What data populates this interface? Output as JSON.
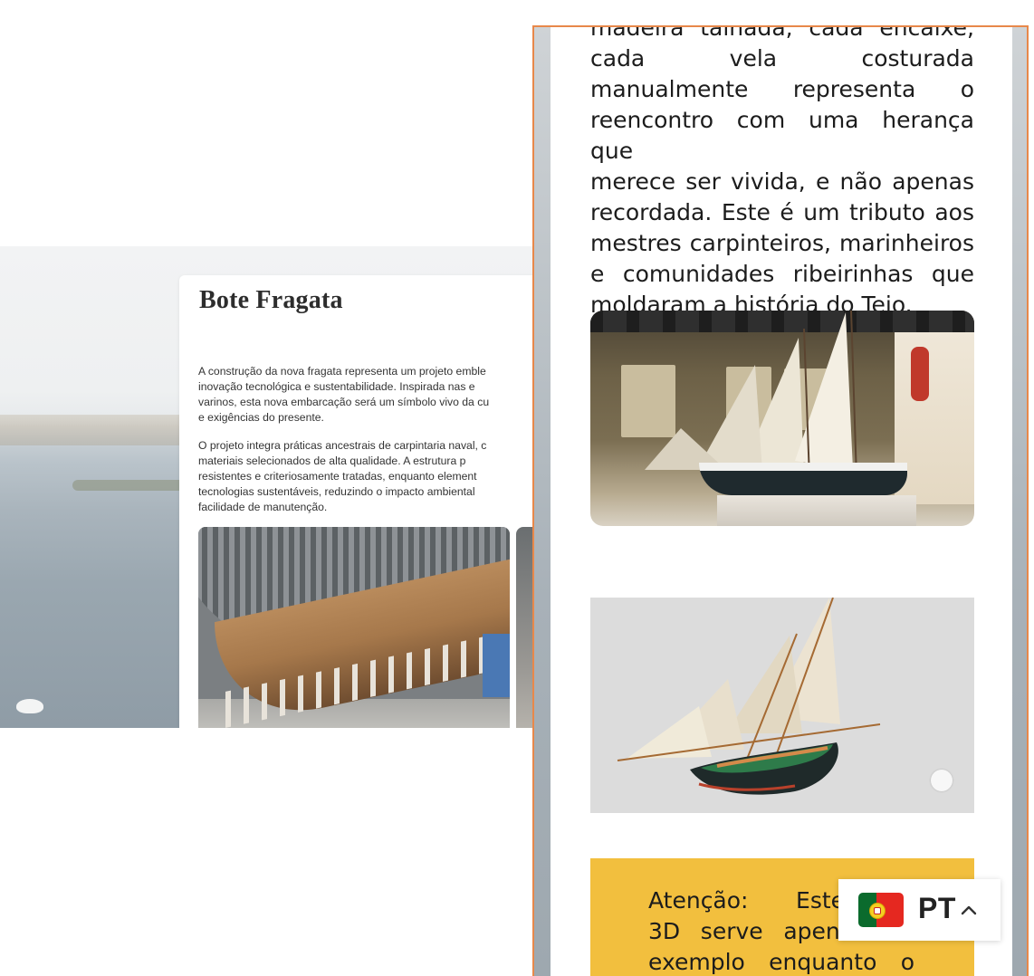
{
  "desktop": {
    "title": "Bote Fragata",
    "paragraph1_lines": [
      "A construção da nova fragata representa um projeto emble",
      "inovação tecnológica e sustentabilidade. Inspirada nas e",
      "varinos, esta nova embarcação será um símbolo vivo da cu",
      "e exigências do presente."
    ],
    "paragraph2_lines": [
      "O projeto integra práticas ancestrais de carpintaria naval, c",
      "materiais selecionados de alta qualidade. A estrutura p",
      "resistentes e criteriosamente tratadas, enquanto element",
      "tecnologias sustentáveis, reduzindo o impacto ambiental",
      "facilidade de manutenção."
    ]
  },
  "mobile": {
    "story_lines": [
      "madeira talhada, cada encaixe,",
      "cada vela costurada",
      "manualmente representa o",
      "reencontro com uma herança que",
      "merece ser vivida, e não apenas",
      "recordada. Este é um tributo aos",
      "mestres carpinteiros, marinheiros",
      "e comunidades ribeirinhas que",
      "moldaram a história do Tejo."
    ],
    "notice_lines": [
      "Atenção: Este m",
      "3D serve apenas de",
      "exemplo enquanto o"
    ]
  },
  "language": {
    "code": "PT",
    "flag": "portugal-flag-icon"
  },
  "colors": {
    "frame_border": "#e8884a",
    "notice_bg": "#f2bf3e"
  }
}
